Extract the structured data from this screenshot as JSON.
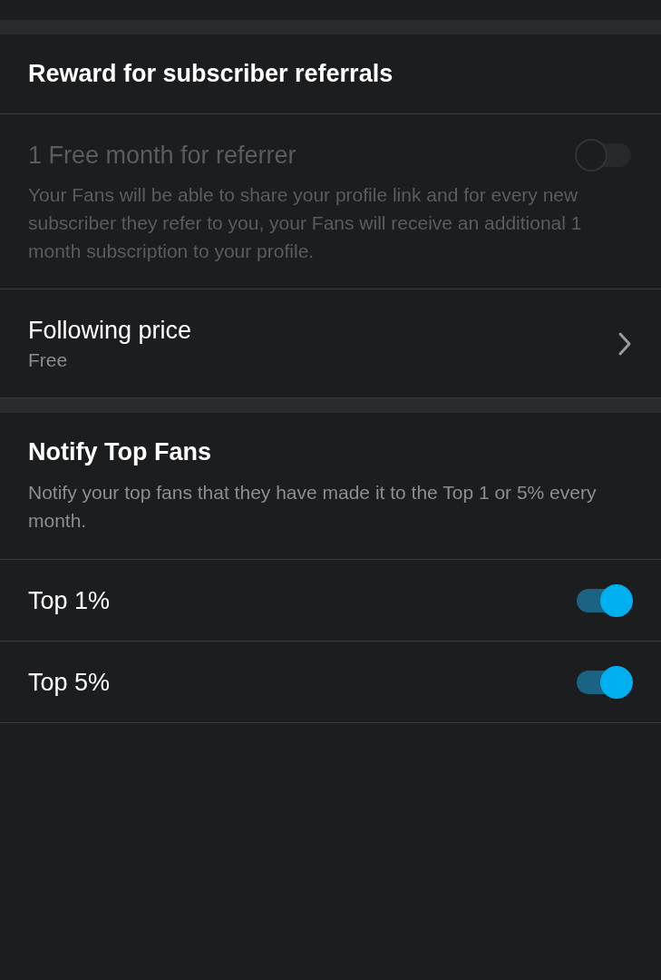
{
  "sections": [
    {
      "title": "Reward for subscriber referrals",
      "rows": [
        {
          "kind": "toggle",
          "label": "1 Free month for referrer",
          "description": "Your Fans will be able to share your profile link and for every new subscriber they refer to you, your Fans will receive an additional 1 month subscription to your profile.",
          "on": false,
          "disabled": true
        },
        {
          "kind": "link",
          "label": "Following price",
          "value": "Free"
        }
      ]
    },
    {
      "title": "Notify Top Fans",
      "description": "Notify your top fans that they have made it to the Top 1 or 5% every month.",
      "rows": [
        {
          "kind": "toggle",
          "label": "Top 1%",
          "on": true,
          "disabled": false
        },
        {
          "kind": "toggle",
          "label": "Top 5%",
          "on": true,
          "disabled": false
        }
      ]
    }
  ]
}
